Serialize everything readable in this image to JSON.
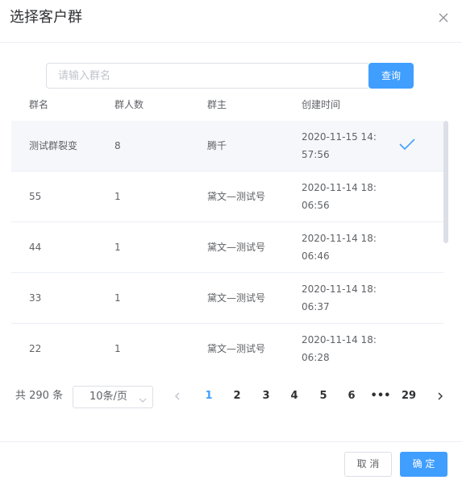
{
  "dialog": {
    "title": "选择客户群"
  },
  "search": {
    "placeholder": "请输入群名",
    "button_label": "查询"
  },
  "table": {
    "columns": [
      "群名",
      "群人数",
      "群主",
      "创建时间"
    ],
    "rows": [
      {
        "name": "测试群裂变",
        "count": "8",
        "owner": "腾千",
        "time": "2020-11-15 14:57:56",
        "selected": true
      },
      {
        "name": "55",
        "count": "1",
        "owner": "黛文—测试号",
        "time": "2020-11-14 18:06:56",
        "selected": false
      },
      {
        "name": "44",
        "count": "1",
        "owner": "黛文—测试号",
        "time": "2020-11-14 18:06:46",
        "selected": false
      },
      {
        "name": "33",
        "count": "1",
        "owner": "黛文—测试号",
        "time": "2020-11-14 18:06:37",
        "selected": false
      },
      {
        "name": "22",
        "count": "1",
        "owner": "黛文—测试号",
        "time": "2020-11-14 18:06:28",
        "selected": false
      }
    ]
  },
  "pagination": {
    "total_label": "共 290 条",
    "page_size": "10条/页",
    "pages": [
      "1",
      "2",
      "3",
      "4",
      "5",
      "6",
      "•••",
      "29"
    ],
    "current_page": "1"
  },
  "footer": {
    "cancel_label": "取 消",
    "confirm_label": "确 定"
  },
  "colors": {
    "accent": "#409eff",
    "border": "#dcdfe6",
    "selected_row_bg": "#f5f7fa",
    "text": "#606266"
  }
}
